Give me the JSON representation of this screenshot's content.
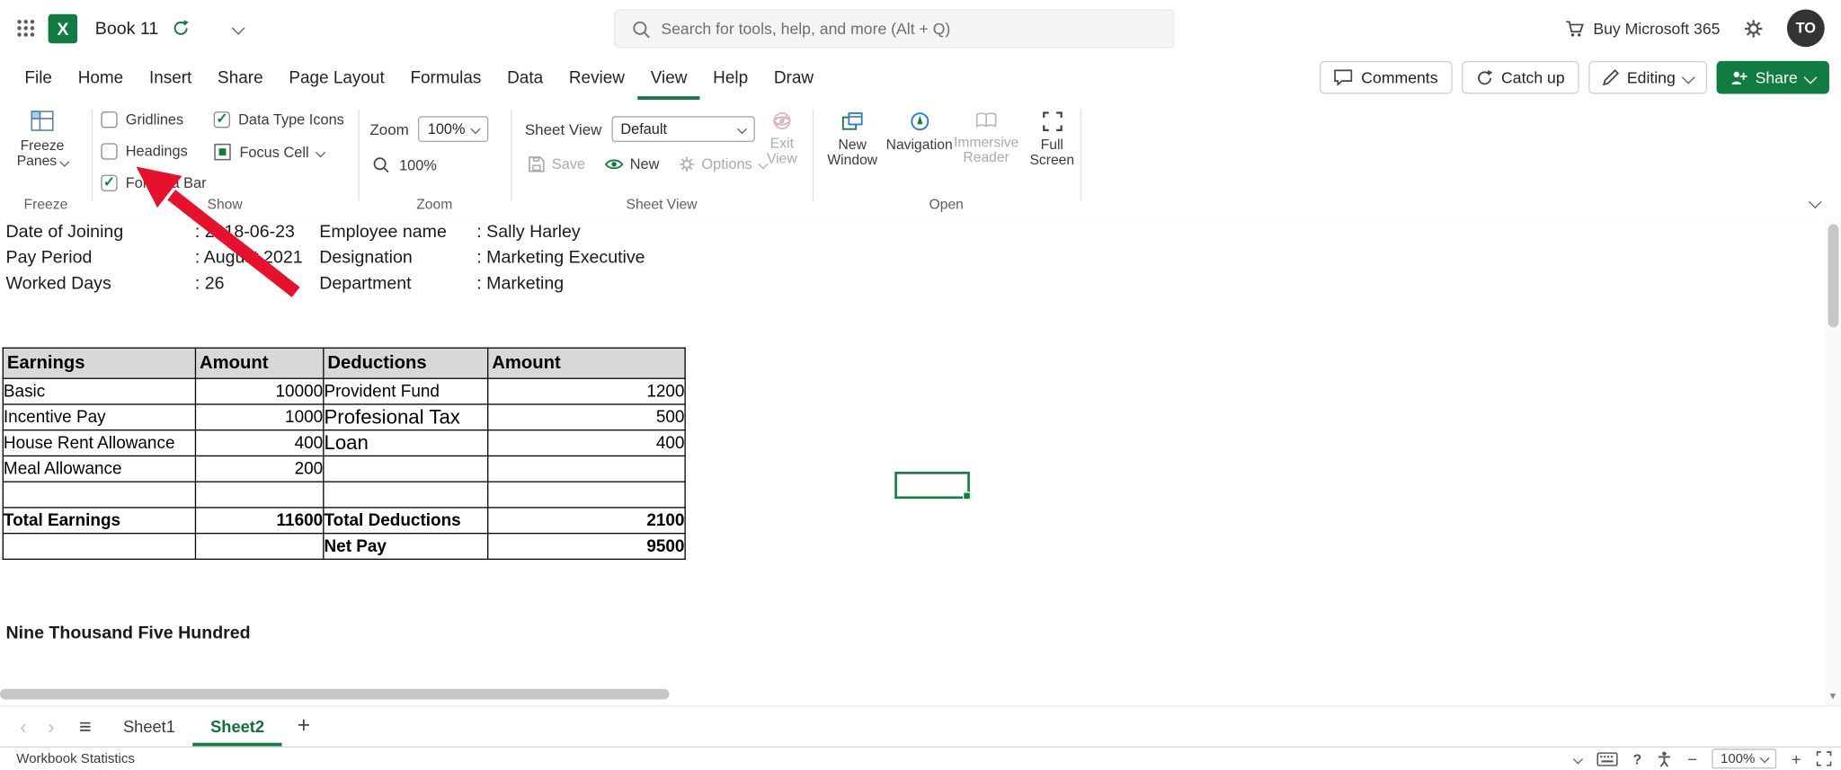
{
  "colors": {
    "excel_green": "#107C41",
    "arrow_red": "#E8112D"
  },
  "topbar": {
    "title": "Book 11",
    "search_placeholder": "Search for tools, help, and more (Alt + Q)",
    "buy_label": "Buy Microsoft 365",
    "avatar_initials": "TO"
  },
  "menubar": {
    "items": [
      "File",
      "Home",
      "Insert",
      "Share",
      "Page Layout",
      "Formulas",
      "Data",
      "Review",
      "View",
      "Help",
      "Draw"
    ],
    "active": "View",
    "comments": "Comments",
    "catch_up": "Catch up",
    "editing": "Editing",
    "share": "Share"
  },
  "ribbon": {
    "freeze": {
      "line1": "Freeze",
      "line2": "Panes",
      "group": "Freeze"
    },
    "show": {
      "group": "Show",
      "gridlines": {
        "label": "Gridlines",
        "checked": false
      },
      "headings": {
        "label": "Headings",
        "checked": false
      },
      "formula_bar": {
        "label": "Formula Bar",
        "checked": true
      },
      "data_type_icons": {
        "label": "Data Type Icons",
        "checked": true
      },
      "focus_cell": {
        "label": "Focus Cell"
      }
    },
    "zoom": {
      "group": "Zoom",
      "label": "Zoom",
      "select_value": "100%",
      "button_label": "100%"
    },
    "sheet_view": {
      "group": "Sheet View",
      "label": "Sheet View",
      "select_value": "Default",
      "save": "Save",
      "new": "New",
      "options": "Options",
      "exit_line1": "Exit",
      "exit_line2": "View"
    },
    "open": {
      "group": "Open",
      "new_window_1": "New",
      "new_window_2": "Window",
      "navigation": "Navigation",
      "immersive_1": "Immersive",
      "immersive_2": "Reader",
      "full_1": "Full",
      "full_2": "Screen"
    }
  },
  "sheet": {
    "info_rows": [
      {
        "label1": "Date of Joining",
        "value1": ": 2018-06-23",
        "label2": "Employee name",
        "value2": ": Sally Harley"
      },
      {
        "label1": "Pay Period",
        "value1": ": August 2021",
        "label2": "Designation",
        "value2": ": Marketing Executive"
      },
      {
        "label1": "Worked Days",
        "value1": ": 26",
        "label2": "Department",
        "value2": ": Marketing"
      }
    ],
    "table": {
      "headers": [
        "Earnings",
        "Amount",
        "Deductions",
        "Amount"
      ],
      "rows": [
        [
          "Basic",
          "10000",
          "Provident Fund",
          "1200"
        ],
        [
          "Incentive Pay",
          "1000",
          "Profesional Tax",
          "500"
        ],
        [
          "House Rent Allowance",
          "400",
          "Loan",
          "400"
        ],
        [
          "Meal Allowance",
          "200",
          "",
          ""
        ],
        [
          "",
          "",
          "",
          ""
        ],
        [
          "Total Earnings",
          "11600",
          "Total Deductions",
          "2100"
        ],
        [
          "",
          "",
          "Net Pay",
          "9500"
        ]
      ]
    },
    "amount_in_words": "Nine Thousand Five Hundred"
  },
  "tabs": {
    "sheet1": "Sheet1",
    "sheet2": "Sheet2"
  },
  "statusbar": {
    "left": "Workbook Statistics",
    "zoom": "100%"
  }
}
